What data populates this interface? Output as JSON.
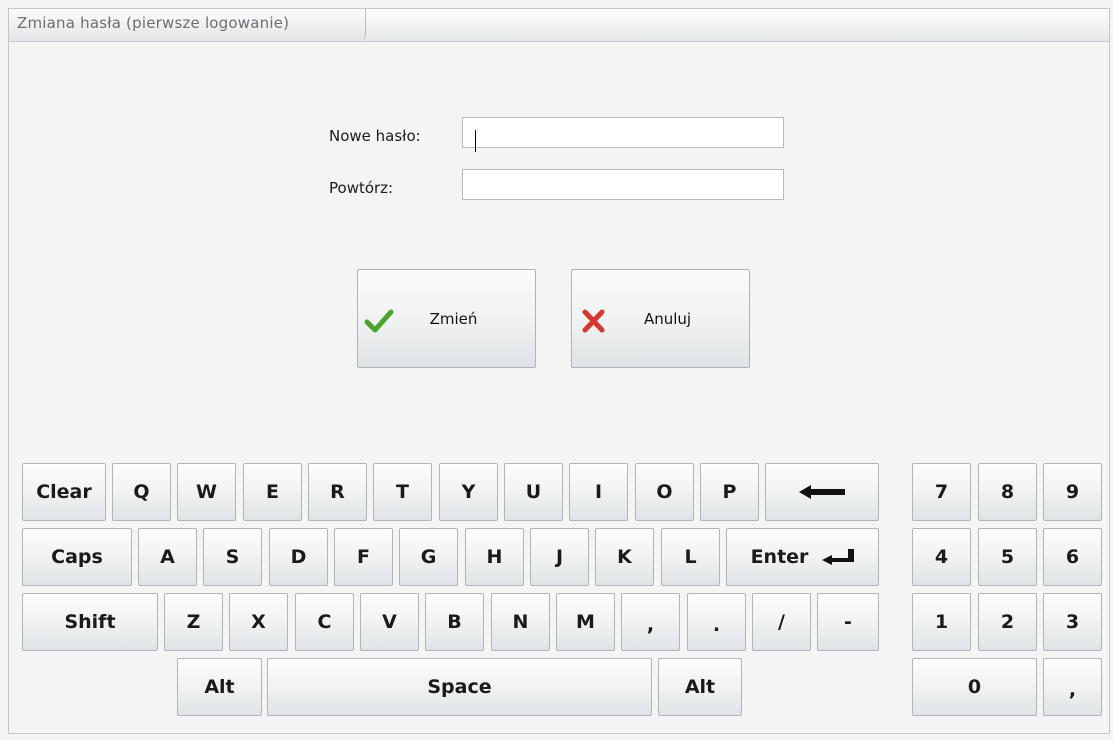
{
  "window": {
    "title": "Zmiana hasła (pierwsze logowanie)"
  },
  "form": {
    "new_password_label": "Nowe hasło:",
    "new_password_value": "",
    "repeat_label": "Powtórz:",
    "repeat_value": ""
  },
  "buttons": {
    "change_label": "Zmień",
    "cancel_label": "Anuluj"
  },
  "keyboard": {
    "row1": [
      "Clear",
      "Q",
      "W",
      "E",
      "R",
      "T",
      "Y",
      "U",
      "I",
      "O",
      "P"
    ],
    "row2": [
      "Caps",
      "A",
      "S",
      "D",
      "F",
      "G",
      "H",
      "J",
      "K",
      "L",
      "Enter"
    ],
    "row3": [
      "Shift",
      "Z",
      "X",
      "C",
      "V",
      "B",
      "N",
      "M",
      ",",
      ".",
      "/",
      "-"
    ],
    "row4": [
      "Alt",
      "Space",
      "Alt"
    ],
    "numpad": [
      "7",
      "8",
      "9",
      "4",
      "5",
      "6",
      "1",
      "2",
      "3",
      "0",
      ","
    ]
  },
  "icons": {
    "change": "checkmark-icon",
    "cancel": "x-icon",
    "backspace": "backspace-arrow-icon",
    "enter": "enter-return-icon"
  },
  "colors": {
    "check_green": "#4aa32a",
    "cancel_red": "#d8362f",
    "background": "#f3f4f4"
  }
}
